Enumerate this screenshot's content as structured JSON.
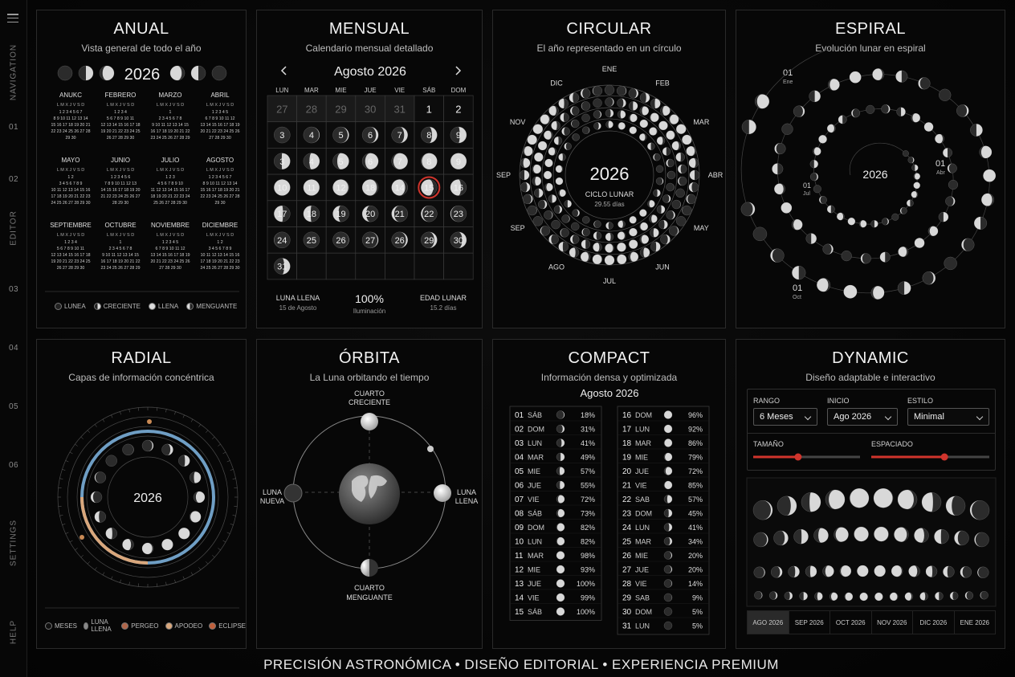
{
  "sidebar": {
    "navigation": "NAVIGATION",
    "editor": "EDITOR",
    "settings": "SETTINGS",
    "help": "HELP",
    "numbers": [
      "01",
      "02",
      "03",
      "04",
      "05",
      "06"
    ]
  },
  "anual": {
    "title": "ANUAL",
    "subtitle": "Vista general de todo el año",
    "year": "2026",
    "months": [
      "ANUKC",
      "FEBRERO",
      "MARZO",
      "ABRIL",
      "MAYO",
      "JUNIO",
      "JULIO",
      "AGOSTO",
      "SEPTIEMBRE",
      "OCTUBRE",
      "NOVIEMBRE",
      "DICIEMBRE"
    ],
    "legend": [
      "LUNEA",
      "CRECIENTE",
      "LLENA",
      "MENGUANTE"
    ]
  },
  "mensual": {
    "title": "MENSUAL",
    "subtitle": "Calendario mensual detallado",
    "month": "Agosto 2026",
    "weekdays": [
      "LUN",
      "MAR",
      "MIE",
      "JUE",
      "VIE",
      "SÁB",
      "DOM"
    ],
    "cells": [
      "27",
      "28",
      "29",
      "30",
      "31",
      "1",
      "2",
      "3",
      "4",
      "5",
      "6",
      "7",
      "8",
      "9",
      "3",
      "4",
      "5",
      "6",
      "7",
      "8",
      "9",
      "10",
      "11",
      "12",
      "18",
      "14",
      "15",
      "16",
      "17",
      "18",
      "19",
      "20",
      "21",
      "22",
      "23",
      "24",
      "25",
      "26",
      "27",
      "26",
      "29",
      "30",
      "31"
    ],
    "stats": [
      {
        "label": "LUNA LLENA",
        "sub": "15 de Agosto"
      },
      {
        "label": "100%",
        "sub": "Iluminación"
      },
      {
        "label": "EDAD LUNAR",
        "sub": "15.2 días"
      }
    ]
  },
  "circular": {
    "title": "CIRCULAR",
    "subtitle": "El año representado en un círculo",
    "year": "2026",
    "cycle": "CICLO LUNAR",
    "days": "29.55 días",
    "months": [
      "ENE",
      "FEB",
      "MAR",
      "ABR",
      "MAY",
      "JUN",
      "JUL",
      "AGO",
      "SEP",
      "SEP",
      "NOV",
      "DIC"
    ]
  },
  "espiral": {
    "title": "ESPIRAL",
    "subtitle": "Evolución lunar en espiral",
    "year": "2026",
    "labels": [
      {
        "n": "01",
        "m": "Ene"
      },
      {
        "n": "01",
        "m": "Abr"
      },
      {
        "n": "01",
        "m": "Jul"
      },
      {
        "n": "01",
        "m": "Oct"
      }
    ]
  },
  "radial": {
    "title": "RADIAL",
    "subtitle": "Capas de información concéntrica",
    "year": "2026",
    "legend": [
      "MESES",
      "LUNA LLENA",
      "PERGEO",
      "APOOEO",
      "ECLIPSE"
    ],
    "colors": {
      "blue": "#6f9ec4",
      "orange": "#c98a55",
      "peach": "#d9a77c"
    }
  },
  "orbita": {
    "title": "ÓRBITA",
    "subtitle": "La Luna orbitando el tiempo",
    "top": [
      "CUARTO",
      "CRECIENTE"
    ],
    "left": [
      "LUNA",
      "NUEVA"
    ],
    "right": [
      "LUNA",
      "LLENA"
    ],
    "bottom": [
      "CUARTO",
      "MENGUANTE"
    ]
  },
  "compact": {
    "title": "COMPACT",
    "subtitle": "Información densa y optimizada",
    "month": "Agosto 2026",
    "left": [
      [
        "01",
        "SÁB",
        "18%"
      ],
      [
        "02",
        "DOM",
        "31%"
      ],
      [
        "03",
        "LUN",
        "41%"
      ],
      [
        "04",
        "MAR",
        "49%"
      ],
      [
        "05",
        "MIE",
        "57%"
      ],
      [
        "06",
        "JUE",
        "55%"
      ],
      [
        "07",
        "VIE",
        "72%"
      ],
      [
        "08",
        "SÁB",
        "73%"
      ],
      [
        "09",
        "DOM",
        "82%"
      ],
      [
        "10",
        "LUN",
        "82%"
      ],
      [
        "11",
        "MAR",
        "98%"
      ],
      [
        "12",
        "MIE",
        "93%"
      ],
      [
        "13",
        "JUE",
        "100%"
      ],
      [
        "14",
        "VIE",
        "99%"
      ],
      [
        "15",
        "SÁB",
        "100%"
      ]
    ],
    "right": [
      [
        "16",
        "DOM",
        "96%"
      ],
      [
        "17",
        "LUN",
        "92%"
      ],
      [
        "18",
        "MAR",
        "86%"
      ],
      [
        "19",
        "MIE",
        "79%"
      ],
      [
        "20",
        "JUE",
        "72%"
      ],
      [
        "21",
        "VIE",
        "85%"
      ],
      [
        "22",
        "SAB",
        "57%"
      ],
      [
        "23",
        "DOM",
        "45%"
      ],
      [
        "24",
        "LUN",
        "41%"
      ],
      [
        "25",
        "MAR",
        "34%"
      ],
      [
        "26",
        "MIE",
        "20%"
      ],
      [
        "27",
        "JUE",
        "20%"
      ],
      [
        "28",
        "VIE",
        "14%"
      ],
      [
        "29",
        "SAB",
        "9%"
      ],
      [
        "30",
        "DOM",
        "5%"
      ],
      [
        "31",
        "LUN",
        "5%"
      ]
    ]
  },
  "dynamic": {
    "title": "DYNAMIC",
    "subtitle": "Diseño adaptable e interactivo",
    "rango_label": "RANGO",
    "rango": "6 Meses",
    "inicio_label": "INICIO",
    "inicio": "Ago 2026",
    "estilo_label": "ESTILO",
    "estilo": "Minimal",
    "tamano_label": "TAMAÑO",
    "espaciado_label": "ESPACIADO",
    "tamano": 0.42,
    "espaciado": 0.62,
    "accent": "#d0342c",
    "tabs": [
      "AGO 2026",
      "SEP 2026",
      "OCT 2026",
      "NOV 2026",
      "DIC 2026",
      "ENE 2026"
    ]
  },
  "footer": "PRECISIÓN ASTRONÓMICA • DISEÑO EDITORIAL • EXPERIENCIA PREMIUM"
}
